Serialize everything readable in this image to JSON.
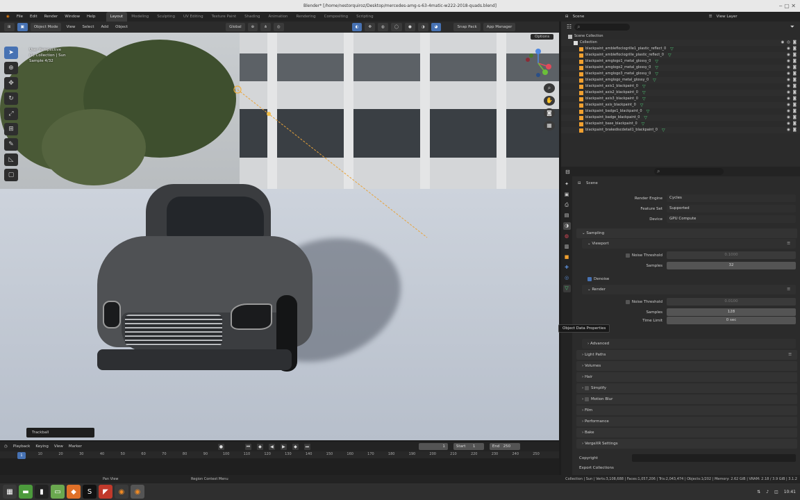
{
  "titlebar": {
    "title": "Blender* [/home/nestorquiroz/Desktop/mercedes-amg-s-63-4matic-w222-2018-quads.blend]"
  },
  "menubar": {
    "menus": [
      "File",
      "Edit",
      "Render",
      "Window",
      "Help"
    ],
    "workspaces": [
      "Layout",
      "Modeling",
      "Sculpting",
      "UV Editing",
      "Texture Paint",
      "Shading",
      "Animation",
      "Rendering",
      "Compositing",
      "Scripting"
    ],
    "active_workspace": "Layout",
    "scene_label": "Scene",
    "view_layer_label": "View Layer"
  },
  "viewport_header": {
    "mode": "Object Mode",
    "menus": [
      "View",
      "Select",
      "Add",
      "Object"
    ],
    "transform": "Global",
    "snap_pack": "Snap Pack",
    "app_manager": "App Manager",
    "options": "Options"
  },
  "viewport": {
    "info": [
      "User Perspective",
      "(1) Collection | Sun",
      "Sample 4/32"
    ],
    "operator_panel": "Trackball"
  },
  "outliner": {
    "root": "Scene Collection",
    "collection": "Collection",
    "items": [
      "blackpaint_amblefloclogrille1_plastic_reflect_0",
      "blackpaint_amblefloclogrille_plastic_reflect_0",
      "blackpaint_amglogo1_metal_glossy_0",
      "blackpaint_amglogo2_metal_glossy_0",
      "blackpaint_amglogo3_metal_glossy_0",
      "blackpaint_amglogo_metal_glossy_0",
      "blackpaint_axis1_blackpaint_0",
      "blackpaint_axis2_blackpaint_0",
      "blackpaint_axis3_blackpaint_0",
      "blackpaint_axis_blackpaint_0",
      "blackpaint_badge1_blackpaint_0",
      "blackpaint_badge_blackpaint_0",
      "blackpaint_base_blackpaint_0",
      "blackpaint_brakediscdetail1_blackpaint_0"
    ]
  },
  "properties": {
    "context": "Scene",
    "render_engine_label": "Render Engine",
    "render_engine": "Cycles",
    "feature_set_label": "Feature Set",
    "feature_set": "Supported",
    "device_label": "Device",
    "device": "GPU Compute",
    "sampling": "Sampling",
    "viewport": "Viewport",
    "noise_threshold_label": "Noise Threshold",
    "viewport_noise_threshold": "0.1000",
    "samples_label": "Samples",
    "viewport_samples": "32",
    "denoise": "Denoise",
    "render": "Render",
    "render_noise_threshold": "0.0100",
    "render_samples": "128",
    "time_limit_label": "Time Limit",
    "time_limit": "0 sec",
    "tooltip": "Object Data Properties",
    "sections": [
      "Advanced",
      "Light Paths",
      "Volumes",
      "Hair",
      "Simplify",
      "Motion Blur",
      "Film",
      "Performance",
      "Bake",
      "VergeXR Settings"
    ],
    "copyright_label": "Copyright",
    "export_label": "Export Collections"
  },
  "timeline": {
    "menus": [
      "Playback",
      "Keying",
      "View",
      "Marker"
    ],
    "current_frame": "1",
    "start_label": "Start",
    "start": "1",
    "end_label": "End",
    "end": "250",
    "ticks": [
      "1",
      "10",
      "20",
      "30",
      "40",
      "50",
      "60",
      "70",
      "80",
      "90",
      "100",
      "110",
      "120",
      "130",
      "140",
      "150",
      "160",
      "170",
      "180",
      "190",
      "200",
      "210",
      "220",
      "230",
      "240",
      "250"
    ]
  },
  "statusbar": {
    "left": "Pan View",
    "mid": "Region Context Menu",
    "right": "Collection | Sun | Verts:3,108,688 | Faces:1,057,206 | Tris:2,043,474 | Objects:1/202 | Memory: 2.62 GiB | VRAM: 2.18 / 3.9 GiB | 3.1.2"
  },
  "taskbar": {
    "time": "10:41"
  }
}
